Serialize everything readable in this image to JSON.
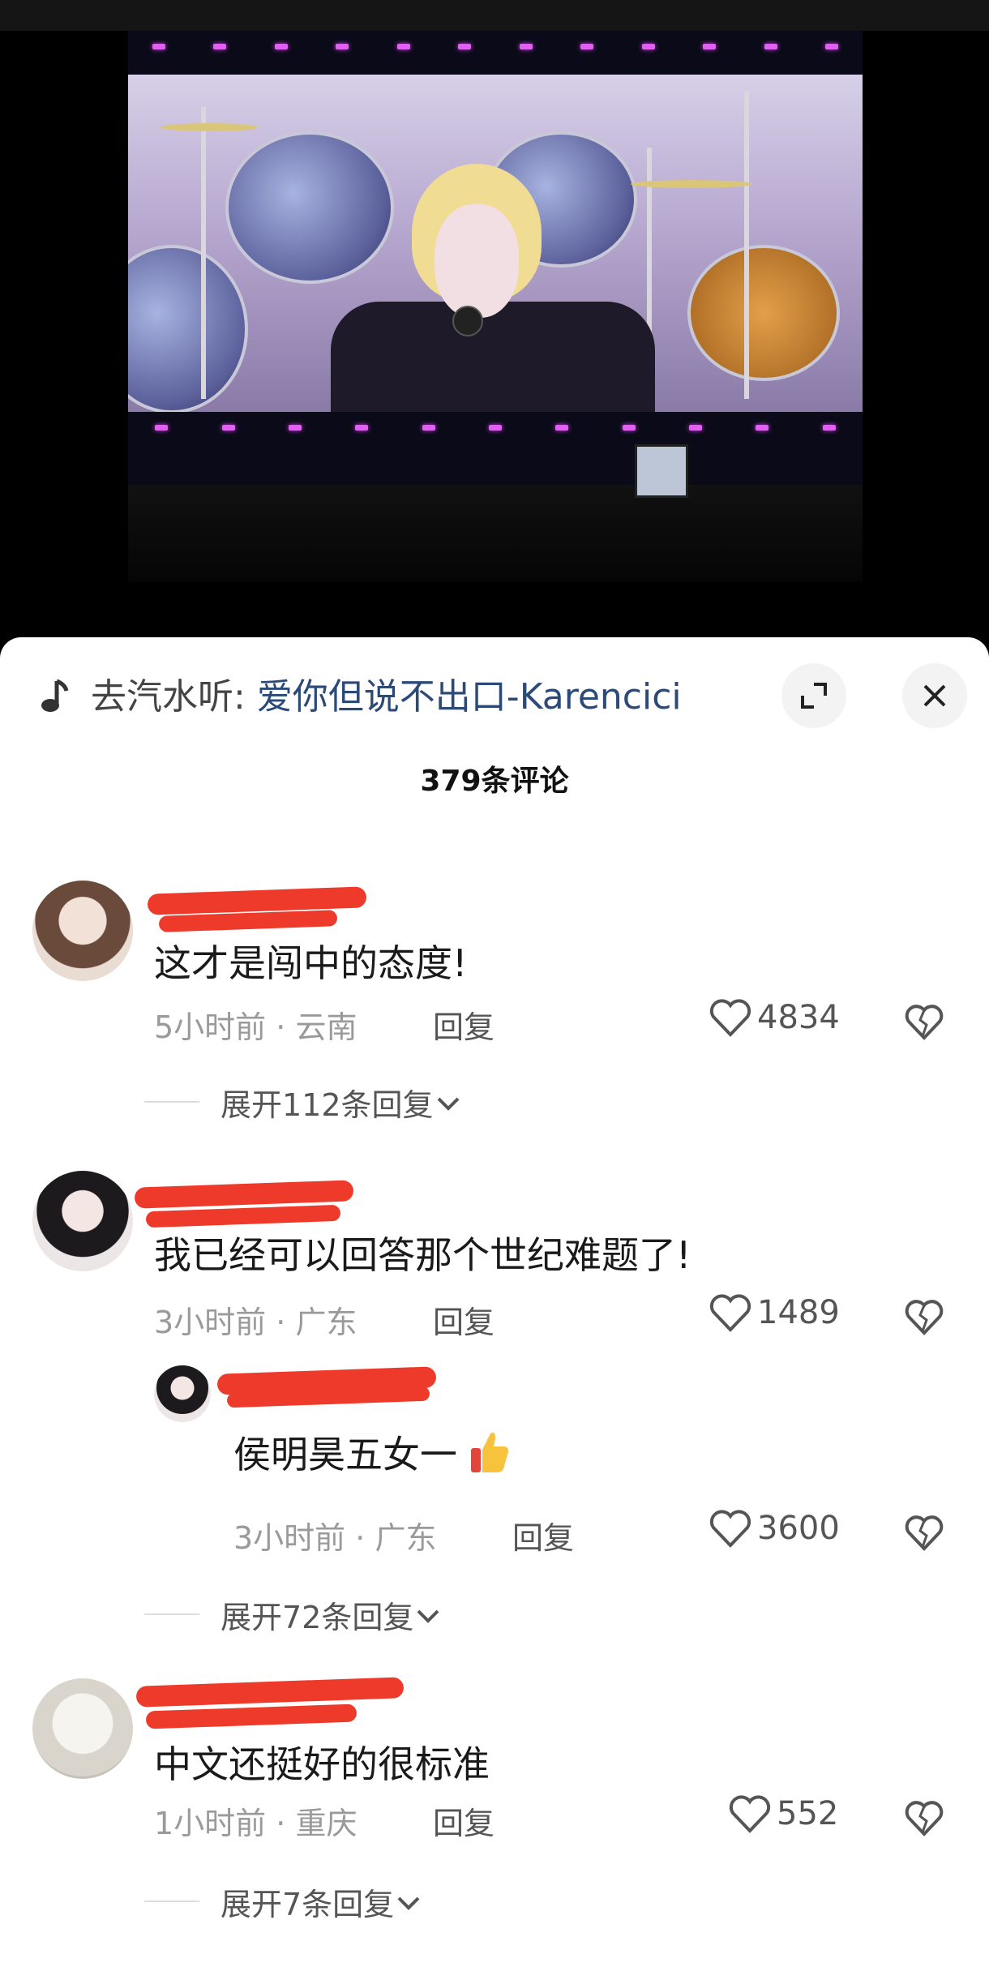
{
  "music": {
    "prefix": "去汽水听: ",
    "song": "爱你但说不出口-Karencici"
  },
  "comments_header": {
    "count_label": "379条评论"
  },
  "comments": [
    {
      "text": "这才是闯中的态度!",
      "time": "5小时前",
      "location": "云南",
      "reply_label": "回复",
      "likes": "4834",
      "expand_label": "展开112条回复"
    },
    {
      "text": "我已经可以回答那个世纪难题了!",
      "time": "3小时前",
      "location": "广东",
      "reply_label": "回复",
      "likes": "1489",
      "reply": {
        "text": "侯明昊五女一",
        "time": "3小时前",
        "location": "广东",
        "reply_label": "回复",
        "likes": "3600"
      },
      "expand_label": "展开72条回复"
    },
    {
      "text": "中文还挺好的很标准",
      "time": "1小时前",
      "location": "重庆",
      "reply_label": "回复",
      "likes": "552",
      "expand_label": "展开7条回复"
    }
  ],
  "meta_separator": " · ",
  "icons": {
    "music": "music-note-icon",
    "expand": "fullscreen-icon",
    "close": "close-icon",
    "like": "heart-icon",
    "dislike": "broken-heart-icon",
    "chevron": "chevron-down-icon",
    "emoji": "thumbs-up-emoji"
  },
  "colors": {
    "song_link": "#2c4a78",
    "redaction": "#ee3a2a",
    "sheet_bg": "#ffffff"
  }
}
